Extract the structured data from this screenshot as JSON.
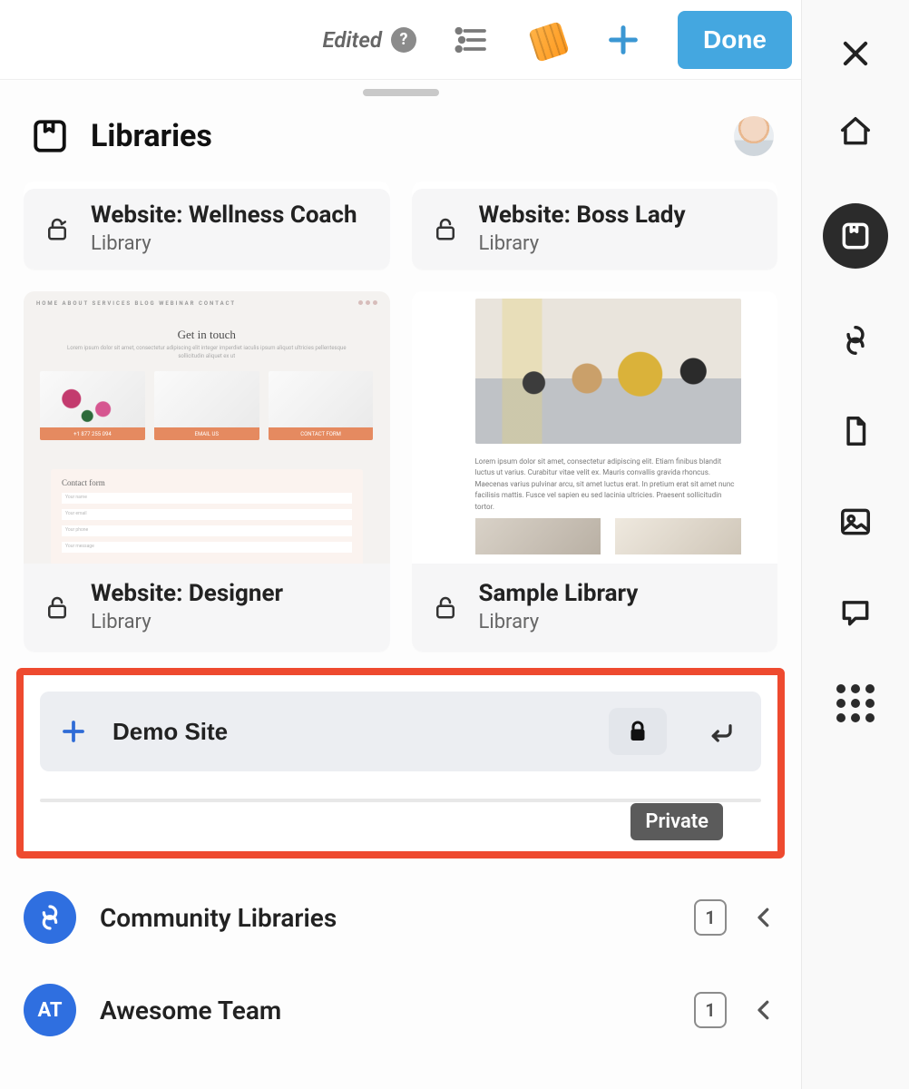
{
  "toolbar": {
    "edited_label": "Edited",
    "done_label": "Done"
  },
  "panel": {
    "title": "Libraries"
  },
  "libraries": [
    {
      "title": "Website: Wellness Coach",
      "subtitle": "Library"
    },
    {
      "title": "Website: Boss Lady",
      "subtitle": "Library"
    },
    {
      "title": "Website: Designer",
      "subtitle": "Library"
    },
    {
      "title": "Sample Library",
      "subtitle": "Library"
    }
  ],
  "thumbA": {
    "nav": "HOME   ABOUT   SERVICES   BLOG   WEBINAR   CONTACT",
    "heading": "Get in touch",
    "sub": "Lorem ipsum dolor sit amet, consectetur adipiscing elit integer imperdiet iaculis ipsum aliquot ultricies pellentesque sollicitudin aliquet ex ut",
    "btn1": "+1 877 255 094",
    "btn2": "EMAIL US",
    "btn3": "CONTACT FORM",
    "form_title": "Contact form",
    "fields": [
      "Your name",
      "Your email",
      "Your phone",
      "Your message"
    ]
  },
  "thumbB": {
    "para": "Lorem ipsum dolor sit amet, consectetur adipiscing elit. Etiam finibus blandit luctus ut varius. Curabitur vitae velit ex. Mauris convallis gravida rhoncus. Maecenas varius pulvinar arcu, sit amet luctus erat. In pretium erat sit amet nunc facilisis mattis. Fusce vel sapien eu sed lacinia ultricies. Praesent sollicitudin tortor."
  },
  "new_library": {
    "value": "Demo Site",
    "tooltip": "Private"
  },
  "sections": {
    "community": {
      "label": "Community Libraries",
      "count": "1"
    },
    "team": {
      "label": "Awesome Team",
      "count": "1",
      "initials": "AT"
    }
  }
}
